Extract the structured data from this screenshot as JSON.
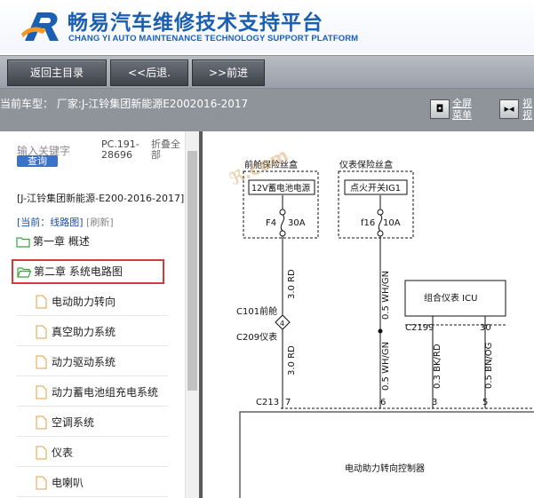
{
  "header": {
    "title": "畅易汽车维修技术支持平台",
    "subtitle": "CHANG YI AUTO MAINTENANCE TECHNOLOGY SUPPORT PLATFORM"
  },
  "nav": {
    "home": "返回主目录",
    "back": "<<后退.",
    "forward": ">>前进"
  },
  "model_bar": {
    "text": "当前车型：  厂家:J-江铃集团新能源E2002016-2017",
    "fullscreen": [
      "全屏",
      "菜单"
    ],
    "view_fragment": [
      "视",
      "视"
    ]
  },
  "sidebar": {
    "search_placeholder": "输入关键字",
    "search_button": "查询",
    "pc_code": "PC.191-28696",
    "collapse_all": "折叠全部",
    "model_name": "[J-江铃集团新能源-E200-2016-2017]",
    "current_prefix": "[当前：线路图]",
    "refresh": "[刷新]",
    "chapters": [
      {
        "label": "第一章 概述",
        "selected": false
      },
      {
        "label": "第二章 系统电路图",
        "selected": true
      }
    ],
    "items": [
      "电动助力转向",
      "真空助力系统",
      "动力驱动系统",
      "动力蓄电池组充电系统",
      "空调系统",
      "仪表",
      "电喇叭"
    ]
  },
  "diagram": {
    "watermark": "ℜ.com",
    "front_box_title": "前舱保险丝盒",
    "front_box_label": "12V蓄电池电源",
    "fuse1_id": "F4",
    "fuse1_rating": "30A",
    "panel_box_title": "仪表保险丝盒",
    "panel_box_label": "点火开关IG1",
    "fuse2_id": "f16",
    "fuse2_rating": "10A",
    "wire_rd": "3.0 RD",
    "wire_whgn": "0.5 WH/GN",
    "wire_bkrd": "0.3 BK/RD",
    "wire_bnog": "0.5 BN/OG",
    "c101": "C101前舱",
    "c209": "C209仪表",
    "connector_num": "4",
    "icu_label": "组合仪表 ICU",
    "c219": "C219",
    "pin9": "9",
    "pin30": "30",
    "c213": "C213",
    "pin7": "7",
    "pin6": "6",
    "pin3": "3",
    "pin5": "5",
    "controller_label": "电动助力转向控制器"
  }
}
